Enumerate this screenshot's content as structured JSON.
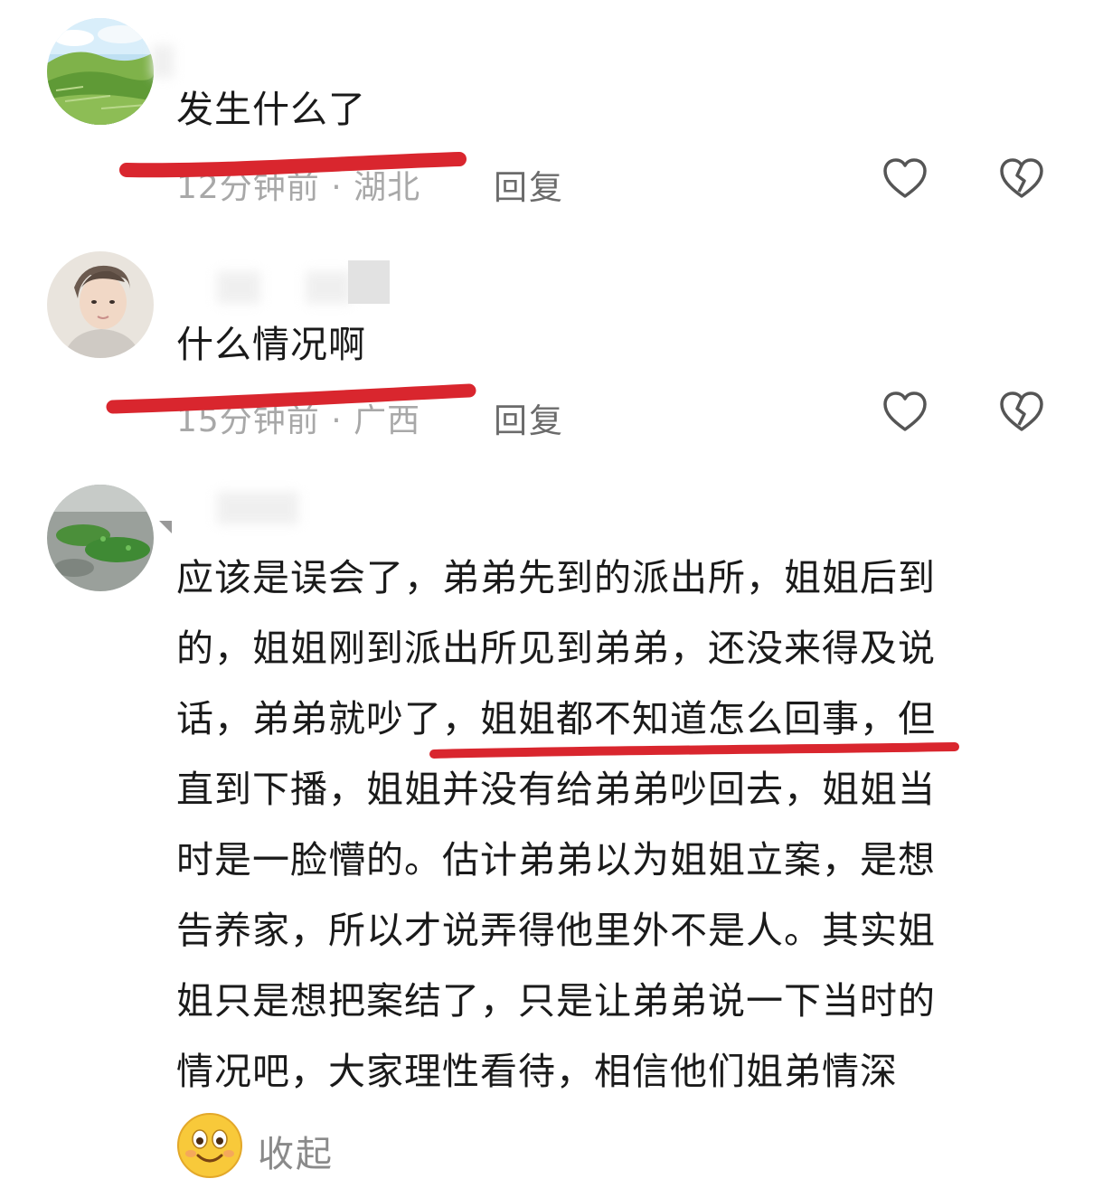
{
  "comments": [
    {
      "text": "发生什么了",
      "time_location": "12分钟前 · 湖北",
      "reply_label": "回复",
      "like_icon": "heart-outline-icon",
      "dislike_icon": "broken-heart-icon"
    },
    {
      "text": "什么情况啊",
      "time_location": "15分钟前 · 广西",
      "reply_label": "回复",
      "like_icon": "heart-outline-icon",
      "dislike_icon": "broken-heart-icon"
    },
    {
      "lines": [
        "应该是误会了，弟弟先到的派出所，姐姐后到",
        "的，姐姐刚到派出所见到弟弟，还没来得及说",
        "话，弟弟就吵了，姐姐都不知道怎么回事，但",
        "直到下播，姐姐并没有给弟弟吵回去，姐姐当",
        "时是一脸懵的。估计弟弟以为姐姐立案，是想",
        "告养家，所以才说弄得他里外不是人。其实姐",
        "姐只是想把案结了，只是让弟弟说一下当时的",
        "情况吧，大家理性看待，相信他们姐弟情深"
      ],
      "collapse_label": "收起",
      "emoji_icon": "smiling-face-emoji-icon"
    }
  ],
  "colors": {
    "annotation_red": "#d9262e",
    "meta_gray": "#a8a8a8",
    "reply_gray": "#6b6b6b"
  }
}
